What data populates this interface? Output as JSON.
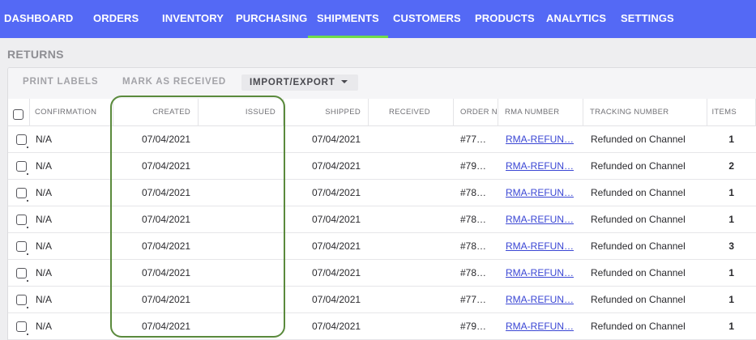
{
  "nav": {
    "items": [
      {
        "label": "DASHBOARD",
        "active": false
      },
      {
        "label": "ORDERS",
        "active": false
      },
      {
        "label": "INVENTORY",
        "active": false
      },
      {
        "label": "PURCHASING",
        "active": false
      },
      {
        "label": "SHIPMENTS",
        "active": true
      },
      {
        "label": "CUSTOMERS",
        "active": false
      },
      {
        "label": "PRODUCTS",
        "active": false
      },
      {
        "label": "ANALYTICS",
        "active": false
      },
      {
        "label": "SETTINGS",
        "active": false
      }
    ],
    "bg_color": "#5469f5",
    "active_underline_color": "#6fdc4a"
  },
  "page": {
    "title": "RETURNS"
  },
  "toolbar": {
    "print_labels": "PRINT LABELS",
    "mark_received": "MARK AS RECEIVED",
    "import_export": "IMPORT/EXPORT"
  },
  "table": {
    "headers": {
      "confirmation": "CONFIRMATION",
      "created": "CREATED",
      "issued": "ISSUED",
      "shipped": "SHIPPED",
      "received": "RECEIVED",
      "order_number": "ORDER N",
      "rma_number": "RMA NUMBER",
      "tracking_number": "TRACKING NUMBER",
      "items": "ITEMS"
    },
    "rows": [
      {
        "confirmation": "N/A",
        "created": "07/04/2021",
        "issued": "",
        "shipped": "07/04/2021",
        "received": "",
        "order": "#77…",
        "rma": "RMA-REFUN…",
        "tracking": "Refunded on Channel",
        "items": "1"
      },
      {
        "confirmation": "N/A",
        "created": "07/04/2021",
        "issued": "",
        "shipped": "07/04/2021",
        "received": "",
        "order": "#79…",
        "rma": "RMA-REFUN…",
        "tracking": "Refunded on Channel",
        "items": "2"
      },
      {
        "confirmation": "N/A",
        "created": "07/04/2021",
        "issued": "",
        "shipped": "07/04/2021",
        "received": "",
        "order": "#78…",
        "rma": "RMA-REFUN…",
        "tracking": "Refunded on Channel",
        "items": "1"
      },
      {
        "confirmation": "N/A",
        "created": "07/04/2021",
        "issued": "",
        "shipped": "07/04/2021",
        "received": "",
        "order": "#78…",
        "rma": "RMA-REFUN…",
        "tracking": "Refunded on Channel",
        "items": "1"
      },
      {
        "confirmation": "N/A",
        "created": "07/04/2021",
        "issued": "",
        "shipped": "07/04/2021",
        "received": "",
        "order": "#78…",
        "rma": "RMA-REFUN…",
        "tracking": "Refunded on Channel",
        "items": "3"
      },
      {
        "confirmation": "N/A",
        "created": "07/04/2021",
        "issued": "",
        "shipped": "07/04/2021",
        "received": "",
        "order": "#78…",
        "rma": "RMA-REFUN…",
        "tracking": "Refunded on Channel",
        "items": "1"
      },
      {
        "confirmation": "N/A",
        "created": "07/04/2021",
        "issued": "",
        "shipped": "07/04/2021",
        "received": "",
        "order": "#77…",
        "rma": "RMA-REFUN…",
        "tracking": "Refunded on Channel",
        "items": "1"
      },
      {
        "confirmation": "N/A",
        "created": "07/04/2021",
        "issued": "",
        "shipped": "07/04/2021",
        "received": "",
        "order": "#79…",
        "rma": "RMA-REFUN…",
        "tracking": "Refunded on Channel",
        "items": "1"
      }
    ]
  },
  "annotation": {
    "highlight_color": "#5a8a3c"
  }
}
